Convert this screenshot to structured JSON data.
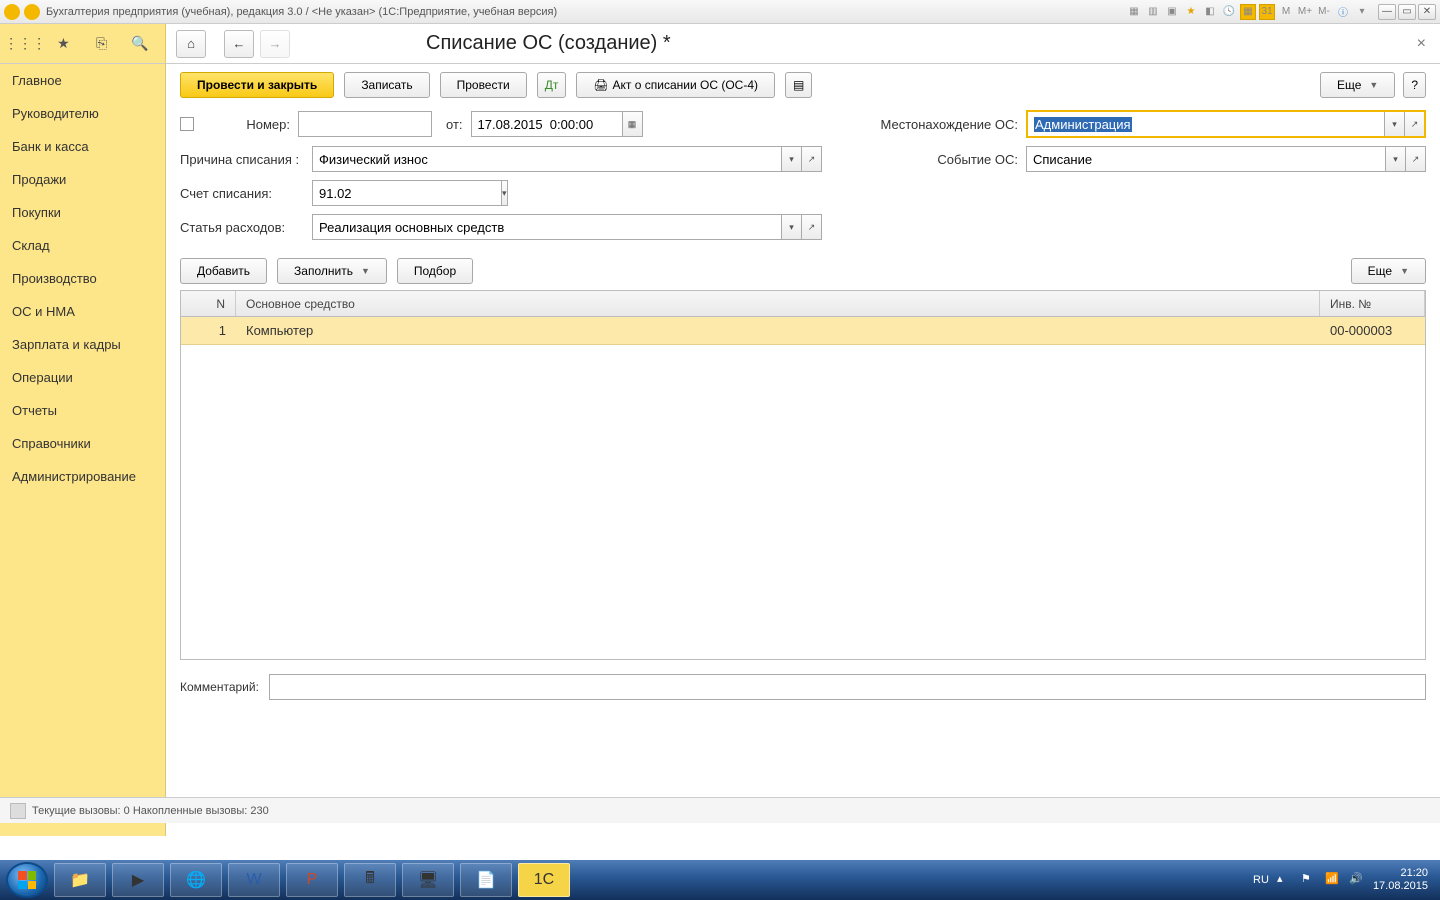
{
  "titlebar": {
    "text": "Бухгалтерия предприятия (учебная), редакция 3.0 / <Не указан>  (1С:Предприятие, учебная версия)",
    "mem_labels": [
      "M",
      "M+",
      "M-"
    ]
  },
  "sidebar": {
    "items": [
      {
        "label": "Главное"
      },
      {
        "label": "Руководителю"
      },
      {
        "label": "Банк и касса"
      },
      {
        "label": "Продажи"
      },
      {
        "label": "Покупки"
      },
      {
        "label": "Склад"
      },
      {
        "label": "Производство"
      },
      {
        "label": "ОС и НМА"
      },
      {
        "label": "Зарплата и кадры"
      },
      {
        "label": "Операции"
      },
      {
        "label": "Отчеты"
      },
      {
        "label": "Справочники"
      },
      {
        "label": "Администрирование"
      }
    ]
  },
  "doc": {
    "title": "Списание ОС (создание) *"
  },
  "cmdbar": {
    "post_close": "Провести и закрыть",
    "save": "Записать",
    "post": "Провести",
    "act": "Акт о списании ОС (ОС-4)",
    "more": "Еще",
    "help": "?"
  },
  "form": {
    "number_label": "Номер:",
    "number_value": "",
    "from_label": "от:",
    "date_value": "17.08.2015  0:00:00",
    "location_label": "Местонахождение ОС:",
    "location_value": "Администрация",
    "reason_label": "Причина списания :",
    "reason_value": "Физический износ",
    "event_label": "Событие ОС:",
    "event_value": "Списание",
    "account_label": "Счет списания:",
    "account_value": "91.02",
    "expense_label": "Статья расходов:",
    "expense_value": "Реализация основных средств"
  },
  "tablebar": {
    "add": "Добавить",
    "fill": "Заполнить",
    "pick": "Подбор",
    "more": "Еще"
  },
  "table": {
    "col_n": "N",
    "col_asset": "Основное средство",
    "col_inv": "Инв. №",
    "rows": [
      {
        "n": "1",
        "asset": "Компьютер",
        "inv": "00-000003"
      }
    ]
  },
  "comment": {
    "label": "Комментарий:",
    "value": ""
  },
  "status": {
    "text": "Текущие вызовы: 0  Накопленные вызовы: 230"
  },
  "tray": {
    "lang": "RU",
    "time": "21:20",
    "date": "17.08.2015"
  }
}
